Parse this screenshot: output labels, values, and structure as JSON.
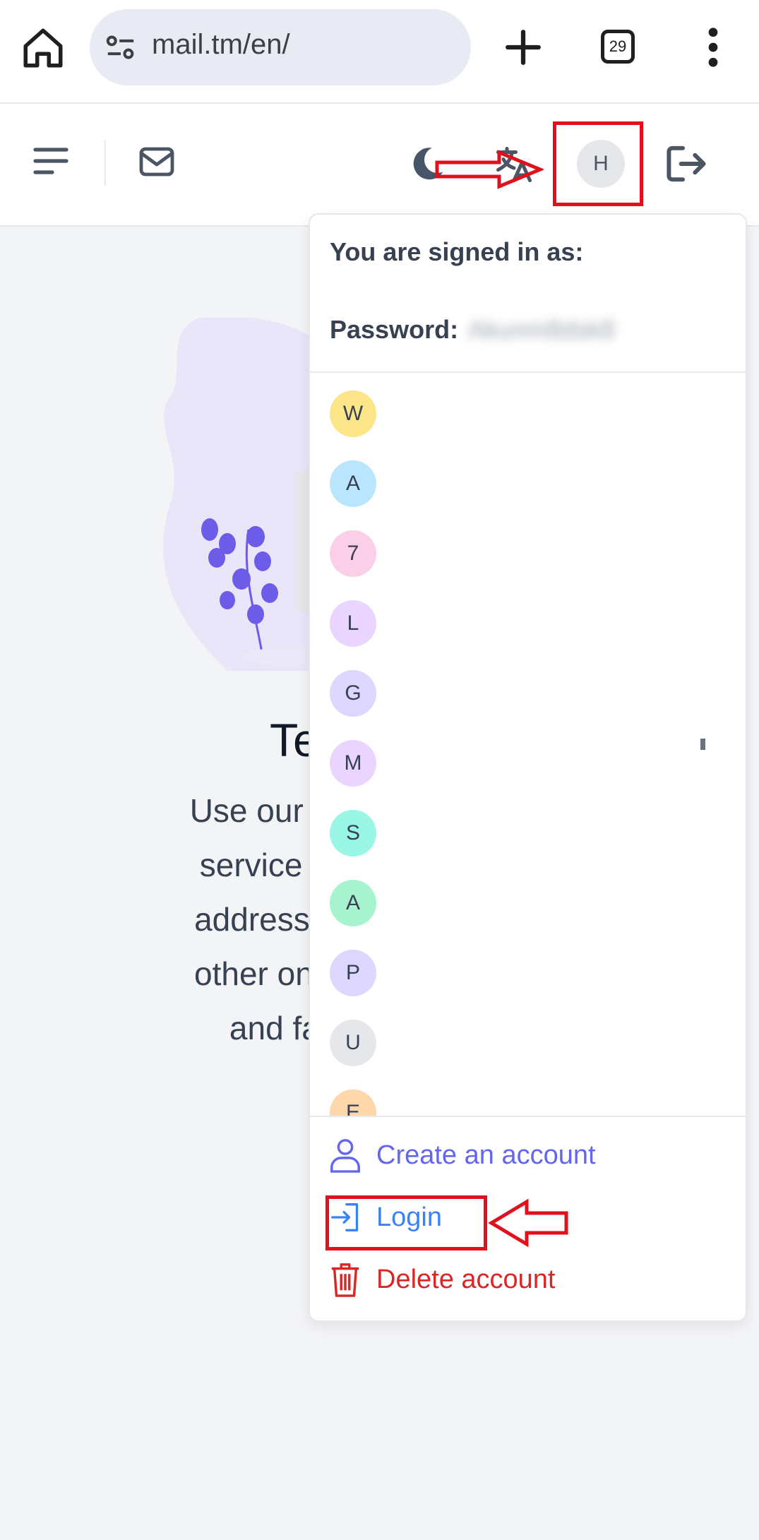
{
  "browser": {
    "url": "mail.tm/en/",
    "tab_count": "29",
    "icons": [
      "home-icon",
      "site-settings-icon",
      "plus-icon",
      "tabs-icon",
      "more-vert-icon"
    ]
  },
  "header": {
    "avatar_initial": "H",
    "icons": [
      "hamburger-icon",
      "mail-icon",
      "moon-icon",
      "translate-icon",
      "logout-icon"
    ]
  },
  "hero": {
    "title_partial": "Te",
    "lines": [
      "Use our free tem",
      "service to prote",
      "address from sp",
      "other online abu",
      "and fast ter"
    ]
  },
  "dropdown": {
    "signed_in_label": "You are signed in as:",
    "password_label": "Password:",
    "password_value": "Akunm8dsk8",
    "accounts": [
      {
        "initial": "W",
        "color": "#fde68a"
      },
      {
        "initial": "A",
        "color": "#bae6fd"
      },
      {
        "initial": "7",
        "color": "#fbcfe8"
      },
      {
        "initial": "L",
        "color": "#e9d5ff"
      },
      {
        "initial": "G",
        "color": "#ddd6fe"
      },
      {
        "initial": "M",
        "color": "#e9d5ff"
      },
      {
        "initial": "S",
        "color": "#99f6e4"
      },
      {
        "initial": "A",
        "color": "#a7f3d0"
      },
      {
        "initial": "P",
        "color": "#ddd6fe"
      },
      {
        "initial": "U",
        "color": "#e5e7eb"
      },
      {
        "initial": "E",
        "color": "#fed7aa"
      }
    ],
    "actions": {
      "create": "Create an account",
      "login": "Login",
      "delete": "Delete account"
    }
  },
  "colors": {
    "annotation": "#e0101c",
    "create": "#6366f1",
    "login": "#3b82f6",
    "delete": "#dc2626"
  }
}
